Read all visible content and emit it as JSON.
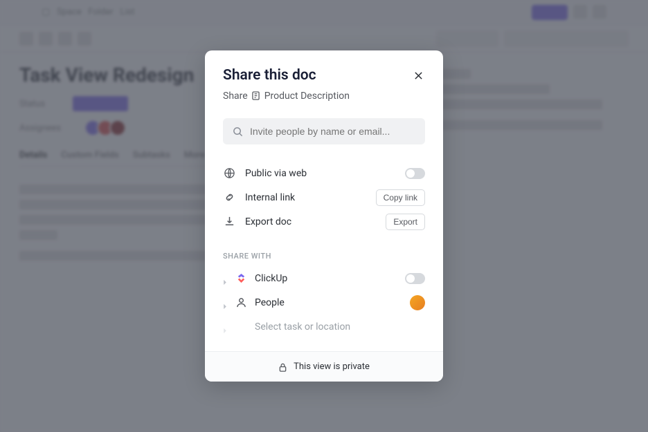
{
  "background": {
    "title": "Task View Redesign",
    "status_label": "Status",
    "assignees_label": "Assignees"
  },
  "modal": {
    "title": "Share this doc",
    "subtitle_prefix": "Share",
    "doc_name": "Product Description",
    "search": {
      "placeholder": "Invite people by name or email..."
    },
    "options": {
      "public": {
        "label": "Public via web"
      },
      "internal": {
        "label": "Internal link",
        "btn": "Copy link"
      },
      "export": {
        "label": "Export doc",
        "btn": "Export"
      }
    },
    "share_with_label": "SHARE WITH",
    "share_items": {
      "clickup": "ClickUp",
      "people": "People",
      "select": "Select task or location"
    },
    "footer": "This view is private"
  }
}
